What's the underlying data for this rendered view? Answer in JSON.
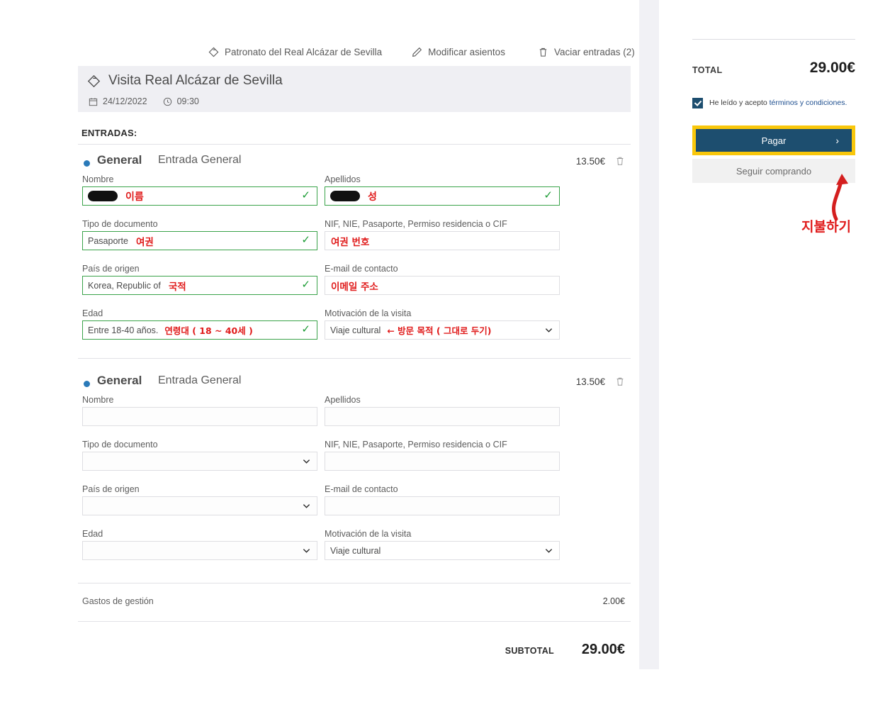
{
  "toolbar": {
    "items": [
      {
        "icon": "diamond-icon",
        "label": "Patronato del Real Alcázar de Sevilla"
      },
      {
        "icon": "pencil-icon",
        "label": "Modificar asientos"
      },
      {
        "icon": "trash-icon",
        "label": "Vaciar entradas (2)"
      }
    ]
  },
  "event": {
    "icon": "diamond-icon",
    "title": "Visita Real Alcázar de Sevilla",
    "date": "24/12/2022",
    "time": "09:30"
  },
  "section_label": "ENTRADAS:",
  "labels": {
    "nombre": "Nombre",
    "apellidos": "Apellidos",
    "tipo_documento": "Tipo de documento",
    "documento_num": "NIF, NIE, Pasaporte, Permiso residencia o CIF",
    "pais": "País de origen",
    "email": "E-mail de contacto",
    "edad": "Edad",
    "motivacion": "Motivación de la visita"
  },
  "tickets": [
    {
      "name": "General",
      "desc": "Entrada General",
      "price": "13.50€",
      "nombre_value": "",
      "nombre_redacted": true,
      "apellidos_value": "",
      "apellidos_redacted": true,
      "tipo_documento_value": "Pasaporte",
      "documento_num_value": "",
      "pais_value": "Korea, Republic of",
      "email_value": "",
      "edad_value": "Entre 18-40 años.",
      "motivacion_value": "Viaje cultural",
      "annotations": {
        "nombre": "이름",
        "apellidos": "성",
        "tipo_documento": "여권",
        "documento_num": "여권 번호",
        "pais": "국적",
        "email": "이메일 주소",
        "edad": "연령대 ( 18 ~ 40세 )",
        "motivacion": "← 방문 목적 ( 그대로 두기)"
      }
    },
    {
      "name": "General",
      "desc": "Entrada General",
      "price": "13.50€",
      "nombre_value": "",
      "nombre_redacted": false,
      "apellidos_value": "",
      "apellidos_redacted": false,
      "tipo_documento_value": "",
      "documento_num_value": "",
      "pais_value": "",
      "email_value": "",
      "edad_value": "",
      "motivacion_value": "Viaje cultural",
      "annotations": {}
    }
  ],
  "fees": {
    "label": "Gastos de gestión",
    "value": "2.00€"
  },
  "subtotal": {
    "label": "SUBTOTAL",
    "value": "29.00€"
  },
  "aside": {
    "total_label": "TOTAL",
    "total_value": "29.00€",
    "terms_prefix": "He leído y acepto ",
    "terms_link": "términos y condiciones.",
    "pay_label": "Pagar",
    "pay_arrow": "›",
    "continue_label": "Seguir comprando",
    "pay_annotation": "지불하기"
  },
  "colors": {
    "accent_navy": "#1d4e6f",
    "highlight_yellow": "#f9c70b",
    "annotation_red": "#e01b1b",
    "valid_green": "#3aa34a",
    "ticket_dot_blue": "#2a7ab9",
    "link_blue": "#1d4e8f"
  }
}
